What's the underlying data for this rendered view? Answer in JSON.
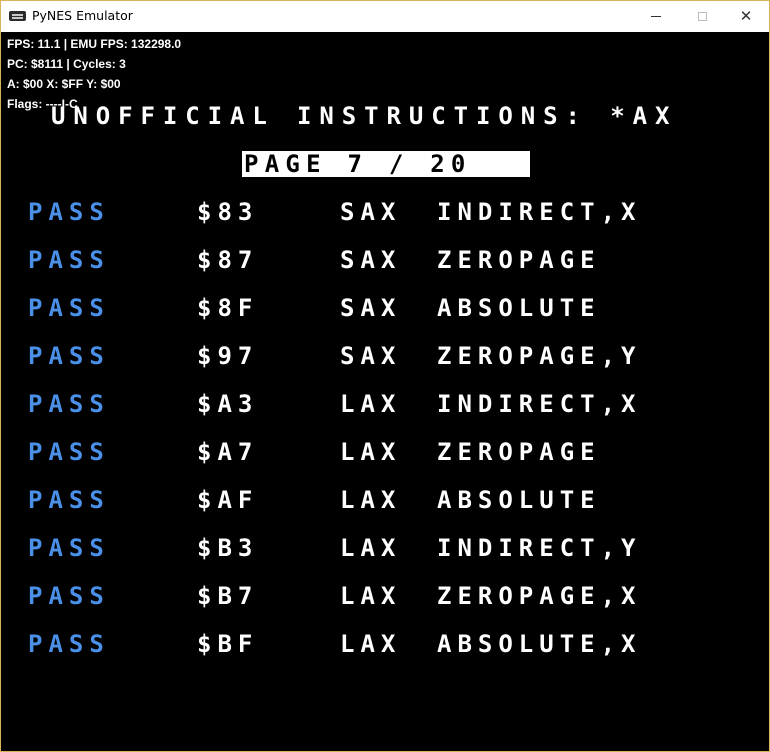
{
  "window": {
    "title": "PyNES Emulator",
    "icon": "pynes-app-icon",
    "controls": {
      "minimize": "minimize-icon",
      "maximize": "maximize-icon",
      "close_glyph": "✕"
    }
  },
  "hud": {
    "line1": "FPS: 11.1 | EMU FPS: 132298.0",
    "line2": "PC: $8111 | Cycles: 3",
    "line3": "A: $00 X: $FF Y: $00",
    "line4": "Flags: ----I-C"
  },
  "screen": {
    "heading": "UNOFFICIAL INSTRUCTIONS: *AX",
    "page": "PAGE  7 / 20",
    "colors": {
      "pass": "#4a8fe8",
      "text": "#ffffff",
      "background": "#000000"
    },
    "rows": [
      {
        "status": "PASS",
        "opcode": "$83",
        "instruction": "SAX",
        "mode": "INDIRECT,X"
      },
      {
        "status": "PASS",
        "opcode": "$87",
        "instruction": "SAX",
        "mode": "ZEROPAGE"
      },
      {
        "status": "PASS",
        "opcode": "$8F",
        "instruction": "SAX",
        "mode": "ABSOLUTE"
      },
      {
        "status": "PASS",
        "opcode": "$97",
        "instruction": "SAX",
        "mode": "ZEROPAGE,Y"
      },
      {
        "status": "PASS",
        "opcode": "$A3",
        "instruction": "LAX",
        "mode": "INDIRECT,X"
      },
      {
        "status": "PASS",
        "opcode": "$A7",
        "instruction": "LAX",
        "mode": "ZEROPAGE"
      },
      {
        "status": "PASS",
        "opcode": "$AF",
        "instruction": "LAX",
        "mode": "ABSOLUTE"
      },
      {
        "status": "PASS",
        "opcode": "$B3",
        "instruction": "LAX",
        "mode": "INDIRECT,Y"
      },
      {
        "status": "PASS",
        "opcode": "$B7",
        "instruction": "LAX",
        "mode": "ZEROPAGE,X"
      },
      {
        "status": "PASS",
        "opcode": "$BF",
        "instruction": "LAX",
        "mode": "ABSOLUTE,X"
      }
    ]
  }
}
